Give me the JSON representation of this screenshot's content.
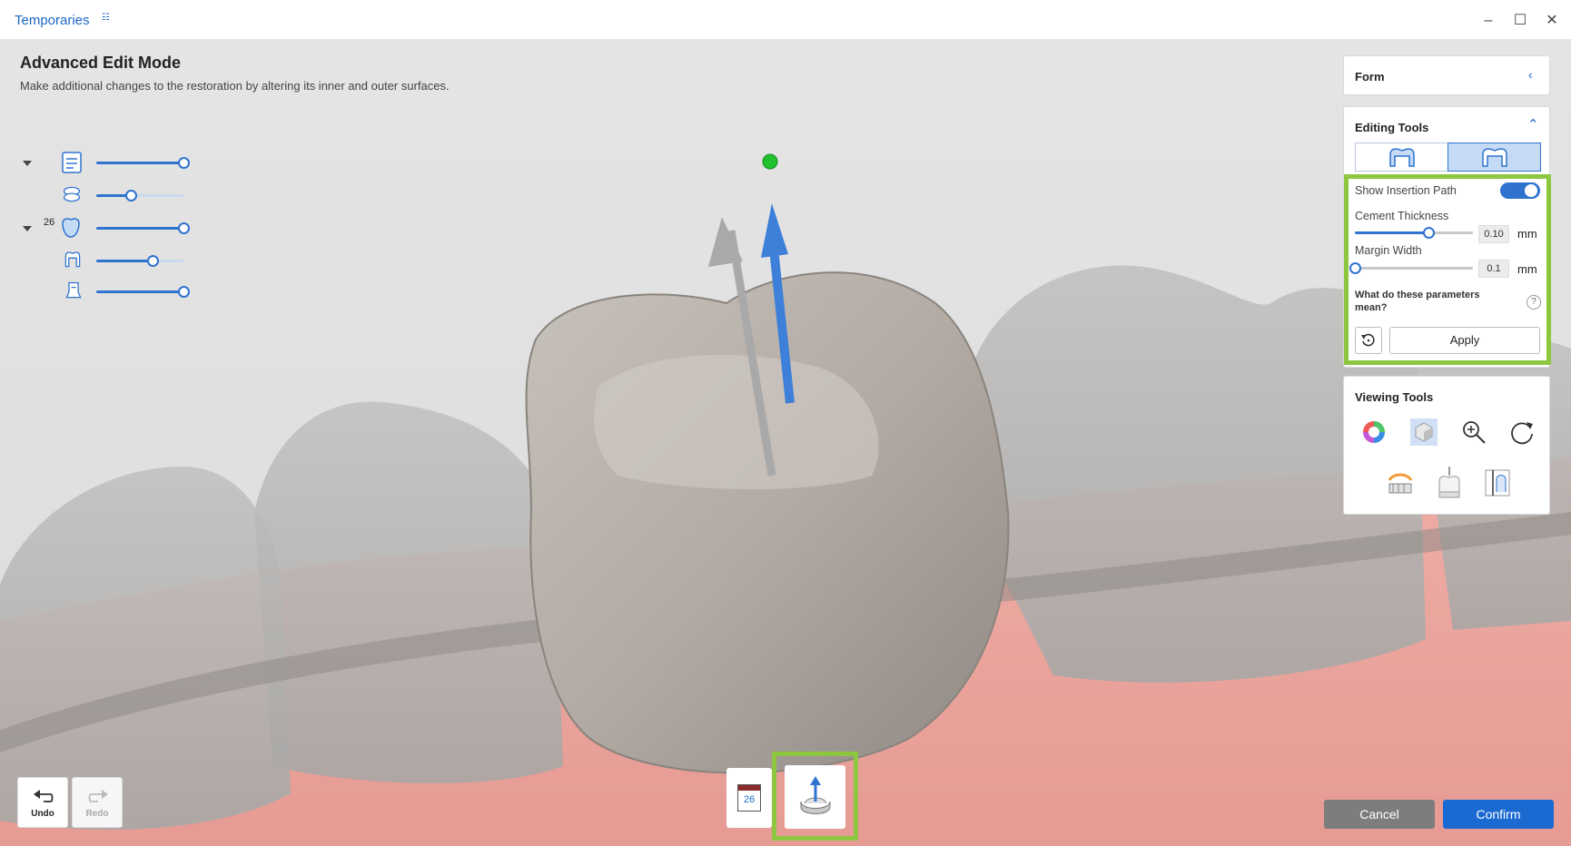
{
  "window": {
    "title": "Temporaries"
  },
  "mode": {
    "title": "Advanced Edit Mode",
    "description": "Make additional changes to the restoration by altering its inner and outer surfaces."
  },
  "layers": {
    "tooth_number": "26",
    "items": [
      {
        "name": "model-layer",
        "level": 1.0
      },
      {
        "name": "antagonist-layer",
        "level": 0.4
      },
      {
        "name": "tooth-26-layer",
        "level": 1.0
      },
      {
        "name": "crown-layer",
        "level": 0.65
      },
      {
        "name": "abutment-layer",
        "level": 1.0
      }
    ]
  },
  "form_panel": {
    "title": "Form"
  },
  "editing_tools": {
    "title": "Editing Tools",
    "show_insertion_path_label": "Show Insertion Path",
    "show_insertion_path_on": true,
    "cement_thickness_label": "Cement Thickness",
    "cement_thickness_value": "0.10",
    "cement_thickness_level": 0.62,
    "margin_width_label": "Margin Width",
    "margin_width_value": "0.1",
    "margin_width_level": 0.0,
    "unit": "mm",
    "help_text": "What do these parameters mean?",
    "help_icon": "?",
    "apply_label": "Apply"
  },
  "viewing_tools": {
    "title": "Viewing Tools"
  },
  "bottom": {
    "undo_label": "Undo",
    "redo_label": "Redo",
    "tooth_badge": "26",
    "cancel_label": "Cancel",
    "confirm_label": "Confirm"
  },
  "colors": {
    "accent": "#1b6ad1",
    "highlight": "#8dc63f",
    "gum": "#e8a59d",
    "tooth": "#b5ada6"
  }
}
